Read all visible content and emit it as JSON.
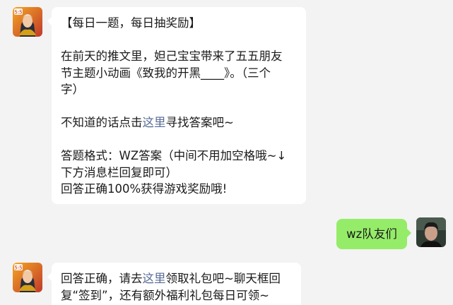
{
  "messages": [
    {
      "sender": "official",
      "avatar_icon": "game-hero-avatar-icon",
      "lines": {
        "l1": "【每日一题，每日抽奖励】",
        "l2": "在前天的推文里，妲己宝宝带来了五五朋友",
        "l3": "节主题小动画《致我的开黑____》。（三个",
        "l4": "字）",
        "l5_pre": "不知道的话点击",
        "l5_link": "这里",
        "l5_post": "寻找答案吧~",
        "l6": "答题格式：WZ答案（中间不用加空格哦~↓",
        "l7": "下方消息栏回复即可）",
        "l8": "回答正确100%获得游戏奖励哦!"
      }
    },
    {
      "sender": "user",
      "avatar_icon": "user-portrait-avatar-icon",
      "text": "wz队友们"
    },
    {
      "sender": "official",
      "avatar_icon": "game-hero-avatar-icon",
      "lines": {
        "l1_pre": "回答正确，请去",
        "l1_link": "这里",
        "l1_post": "领取礼包吧~聊天框回",
        "l2": "复“签到”，还有额外福利礼包每日可领~"
      }
    }
  ],
  "colors": {
    "background": "#f3f3f3",
    "incoming_bubble": "#ffffff",
    "outgoing_bubble": "#95ec69",
    "link": "#576b95"
  }
}
